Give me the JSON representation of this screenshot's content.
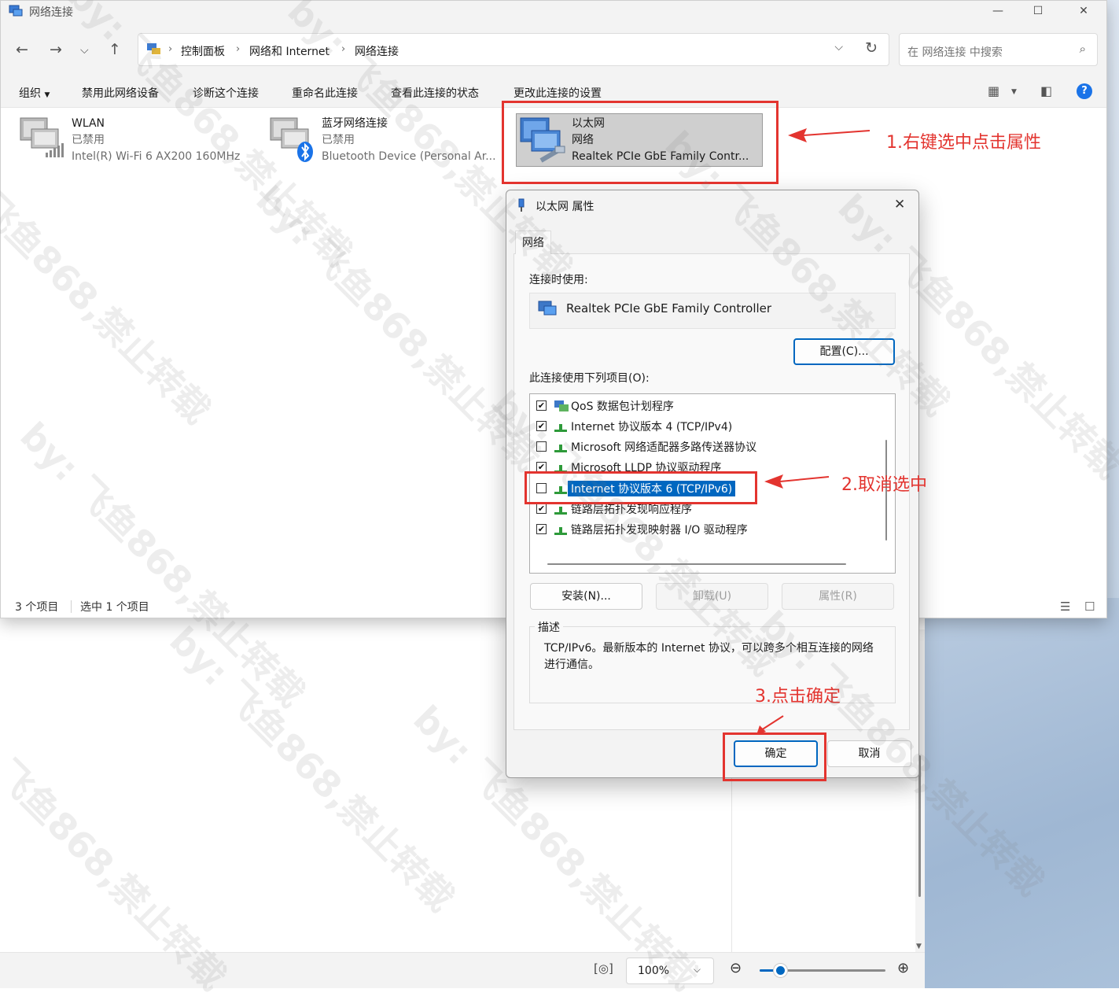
{
  "window": {
    "title": "网络连接",
    "breadcrumb": [
      "控制面板",
      "网络和 Internet",
      "网络连接"
    ],
    "search_placeholder": "在 网络连接 中搜索"
  },
  "commands": [
    "组织",
    "禁用此网络设备",
    "诊断这个连接",
    "重命名此连接",
    "查看此连接的状态",
    "更改此连接的设置"
  ],
  "connections": [
    {
      "name": "WLAN",
      "status": "已禁用",
      "device": "Intel(R) Wi-Fi 6 AX200 160MHz"
    },
    {
      "name": "蓝牙网络连接",
      "status": "已禁用",
      "device": "Bluetooth Device (Personal Ar..."
    },
    {
      "name": "以太网",
      "status": "网络",
      "device": "Realtek PCIe GbE Family Contr..."
    }
  ],
  "statusbar": {
    "count": "3 个项目",
    "selected": "选中 1 个项目"
  },
  "dialog": {
    "title": "以太网 属性",
    "tab": "网络",
    "connect_using_label": "连接时使用:",
    "adapter": "Realtek PCIe GbE Family Controller",
    "configure_button": "配置(C)...",
    "items_label": "此连接使用下列项目(O):",
    "items": [
      {
        "text": "QoS 数据包计划程序",
        "checked": "✔"
      },
      {
        "text": "Internet 协议版本 4 (TCP/IPv4)",
        "checked": "✔"
      },
      {
        "text": "Microsoft 网络适配器多路传送器协议",
        "checked": ""
      },
      {
        "text": "Microsoft LLDP 协议驱动程序",
        "checked": "✔"
      },
      {
        "text": "Internet 协议版本 6 (TCP/IPv6)",
        "checked": ""
      },
      {
        "text": "链路层拓扑发现响应程序",
        "checked": "✔"
      },
      {
        "text": "链路层拓扑发现映射器 I/O 驱动程序",
        "checked": "✔"
      }
    ],
    "install_button": "安装(N)...",
    "uninstall_button": "卸载(U)",
    "properties_button": "属性(R)",
    "description_label": "描述",
    "description": "TCP/IPv6。最新版本的 Internet 协议，可以跨多个相互连接的网络进行通信。",
    "ok_button": "确定",
    "cancel_button": "取消"
  },
  "zoom": {
    "level": "100%"
  },
  "annotations": {
    "step1": "1.右键选中点击属性",
    "step2": "2.取消选中",
    "step3": "3.点击确定",
    "color": "#e3342f"
  },
  "watermark": "by: 飞鱼868,禁止转载",
  "colors": {
    "accent": "#0067c0",
    "annotation": "#e3342f"
  }
}
